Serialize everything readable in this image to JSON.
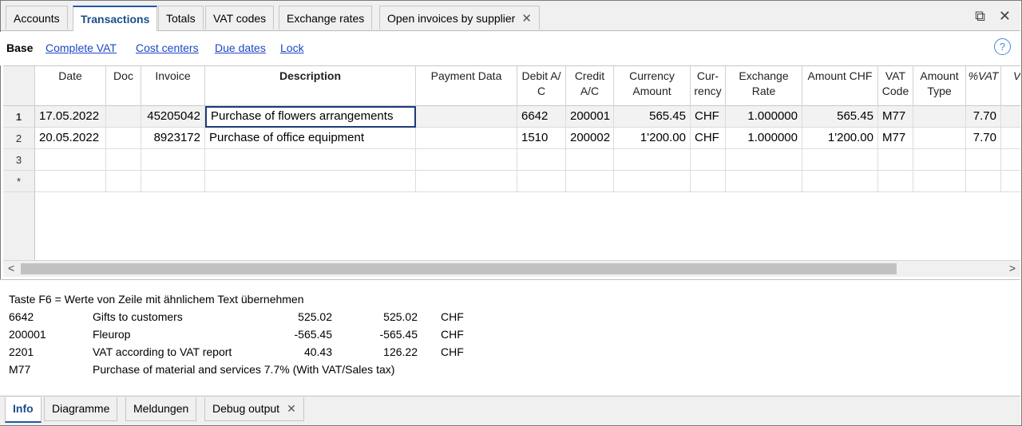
{
  "top_tabs": [
    {
      "label": "Accounts"
    },
    {
      "label": "Transactions"
    },
    {
      "label": "Totals"
    },
    {
      "label": "VAT codes"
    },
    {
      "label": "Exchange rates"
    },
    {
      "label": "Open invoices by supplier"
    }
  ],
  "window_buttons": {
    "restore": "⧉",
    "close": "✕"
  },
  "subnav": {
    "base": "Base",
    "links": [
      "Complete VAT",
      "Cost centers",
      "Due dates",
      "Lock"
    ],
    "help": "?"
  },
  "columns": [
    {
      "key": "date",
      "label": "Date"
    },
    {
      "key": "doc",
      "label": "Doc"
    },
    {
      "key": "invoice",
      "label": "Invoice"
    },
    {
      "key": "description",
      "label": "Description"
    },
    {
      "key": "payment",
      "label": "Payment Data"
    },
    {
      "key": "debit",
      "label": "Debit A/\nC"
    },
    {
      "key": "credit",
      "label": "Credit\nA/C"
    },
    {
      "key": "currency_amount",
      "label": "Currency\nAmount"
    },
    {
      "key": "currency",
      "label": "Cur-\nrency"
    },
    {
      "key": "exchange_rate",
      "label": "Exchange\nRate"
    },
    {
      "key": "amount_chf",
      "label": "Amount CHF"
    },
    {
      "key": "vat_code",
      "label": "VAT\nCode"
    },
    {
      "key": "amount_type",
      "label": "Amount\nType"
    },
    {
      "key": "pct_vat",
      "label": "%VAT"
    },
    {
      "key": "w",
      "label": "V"
    }
  ],
  "rows": [
    {
      "num": "1",
      "date": "17.05.2022",
      "doc": "",
      "invoice": "45205042",
      "description": "Purchase of flowers arrangements",
      "payment": "",
      "debit": "6642",
      "credit": "200001",
      "currency_amount": "565.45",
      "currency": "CHF",
      "exchange_rate": "1.000000",
      "amount_chf": "565.45",
      "vat_code": "M77",
      "amount_type": "",
      "pct_vat": "7.70"
    },
    {
      "num": "2",
      "date": "20.05.2022",
      "doc": "",
      "invoice": "8923172",
      "description": "Purchase of office equipment",
      "payment": "",
      "debit": "1510",
      "credit": "200002",
      "currency_amount": "1'200.00",
      "currency": "CHF",
      "exchange_rate": "1.000000",
      "amount_chf": "1'200.00",
      "vat_code": "M77",
      "amount_type": "",
      "pct_vat": "7.70"
    },
    {
      "num": "3",
      "date": "",
      "doc": "",
      "invoice": "",
      "description": "",
      "payment": "",
      "debit": "",
      "credit": "",
      "currency_amount": "",
      "currency": "",
      "exchange_rate": "",
      "amount_chf": "",
      "vat_code": "",
      "amount_type": "",
      "pct_vat": ""
    },
    {
      "num": "*",
      "date": "",
      "doc": "",
      "invoice": "",
      "description": "",
      "payment": "",
      "debit": "",
      "credit": "",
      "currency_amount": "",
      "currency": "",
      "exchange_rate": "",
      "amount_chf": "",
      "vat_code": "",
      "amount_type": "",
      "pct_vat": ""
    }
  ],
  "scrollbar": {
    "left_arrow": "<",
    "right_arrow": ">"
  },
  "info": {
    "hint": "Taste F6 = Werte von Zeile mit ähnlichem Text übernehmen",
    "lines": [
      {
        "account": "6642",
        "name": "Gifts to customers",
        "amount1": "525.02",
        "amount2": "525.02",
        "currency": "CHF"
      },
      {
        "account": "200001",
        "name": "Fleurop",
        "amount1": "-565.45",
        "amount2": "-565.45",
        "currency": "CHF"
      },
      {
        "account": "2201",
        "name": "VAT according to VAT report",
        "amount1": "40.43",
        "amount2": "126.22",
        "currency": "CHF"
      },
      {
        "account": "M77",
        "name": "Purchase of material and services 7.7% (With VAT/Sales tax)",
        "amount1": "",
        "amount2": "",
        "currency": ""
      }
    ]
  },
  "bottom_tabs": [
    {
      "label": "Info"
    },
    {
      "label": "Diagramme"
    },
    {
      "label": "Meldungen"
    },
    {
      "label": "Debug output"
    }
  ],
  "colors": {
    "link": "#1b47c8",
    "active_tab": "#1a4f8c",
    "accent": "#1e5aa8"
  }
}
